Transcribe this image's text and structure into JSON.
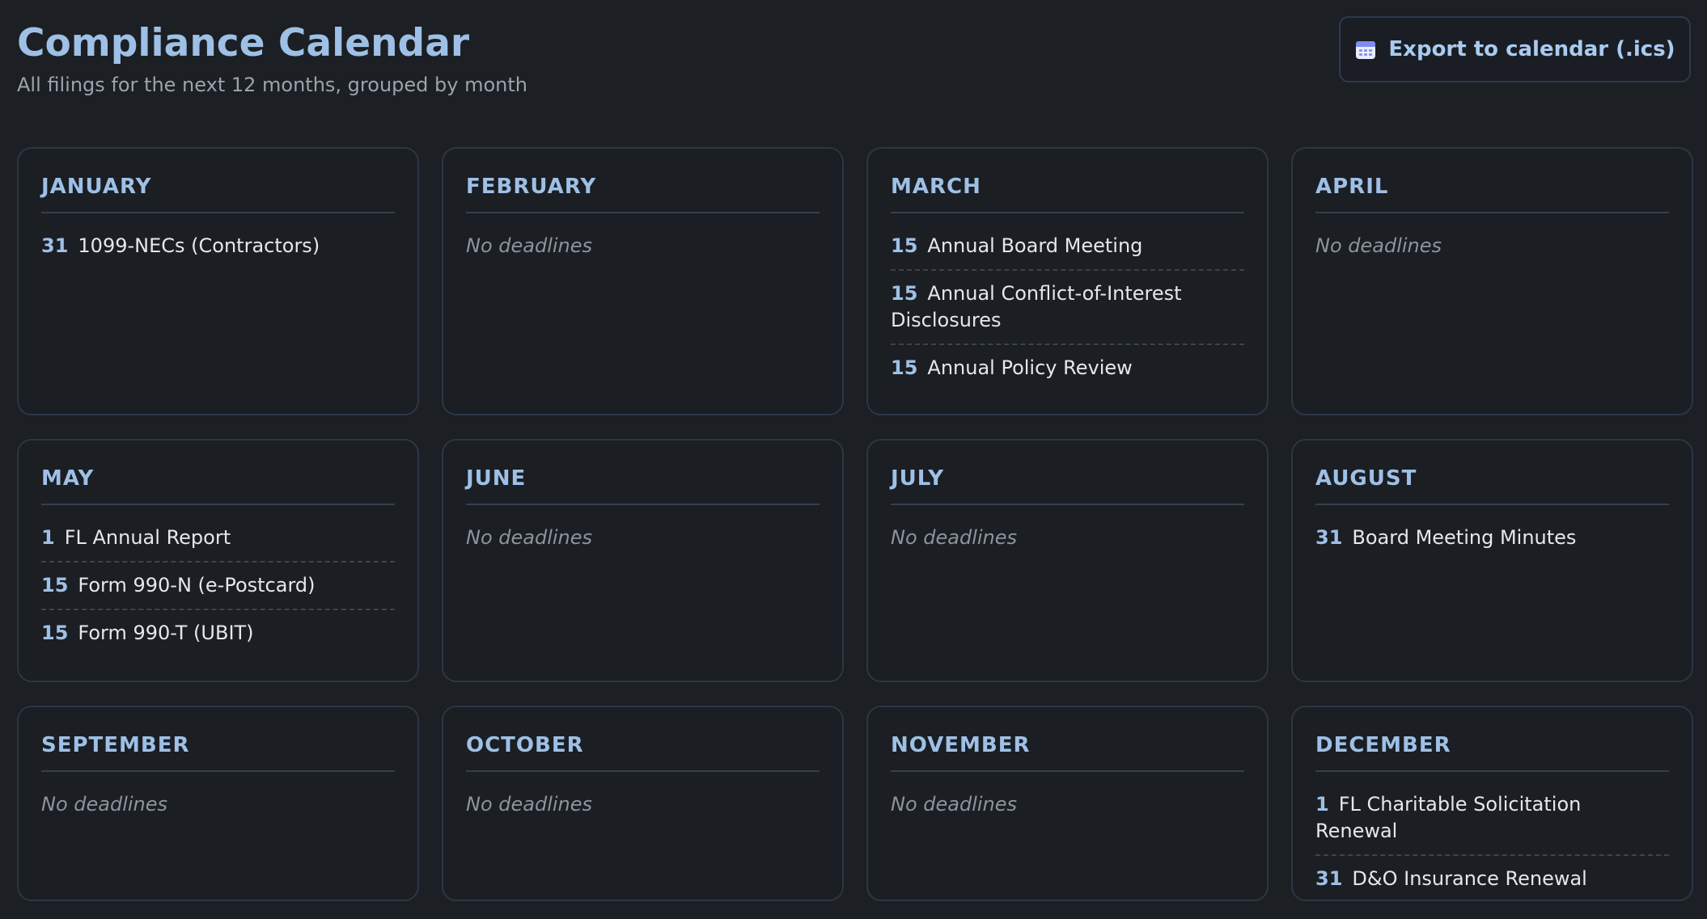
{
  "header": {
    "title": "Compliance Calendar",
    "subtitle": "All filings for the next 12 months, grouped by month"
  },
  "export_button": {
    "label": "Export to calendar (.ics)",
    "icon": "calendar-icon"
  },
  "empty_label": "No deadlines",
  "months": [
    {
      "name": "JANUARY",
      "deadlines": [
        {
          "day": "31",
          "label": "1099-NECs (Contractors)"
        }
      ]
    },
    {
      "name": "FEBRUARY",
      "deadlines": []
    },
    {
      "name": "MARCH",
      "deadlines": [
        {
          "day": "15",
          "label": "Annual Board Meeting"
        },
        {
          "day": "15",
          "label": "Annual Conflict-of-Interest Disclosures"
        },
        {
          "day": "15",
          "label": "Annual Policy Review"
        }
      ]
    },
    {
      "name": "APRIL",
      "deadlines": []
    },
    {
      "name": "MAY",
      "deadlines": [
        {
          "day": "1",
          "label": "FL Annual Report"
        },
        {
          "day": "15",
          "label": "Form 990-N (e-Postcard)"
        },
        {
          "day": "15",
          "label": "Form 990-T (UBIT)"
        }
      ]
    },
    {
      "name": "JUNE",
      "deadlines": []
    },
    {
      "name": "JULY",
      "deadlines": []
    },
    {
      "name": "AUGUST",
      "deadlines": [
        {
          "day": "31",
          "label": "Board Meeting Minutes"
        }
      ]
    },
    {
      "name": "SEPTEMBER",
      "deadlines": []
    },
    {
      "name": "OCTOBER",
      "deadlines": []
    },
    {
      "name": "NOVEMBER",
      "deadlines": []
    },
    {
      "name": "DECEMBER",
      "deadlines": [
        {
          "day": "1",
          "label": "FL Charitable Solicitation Renewal"
        },
        {
          "day": "31",
          "label": "D&O Insurance Renewal"
        }
      ]
    }
  ],
  "colors": {
    "background": "#1c1f23",
    "accent": "#9ec0e6",
    "card_border": "#2c3645",
    "muted_text": "#8d949d"
  }
}
